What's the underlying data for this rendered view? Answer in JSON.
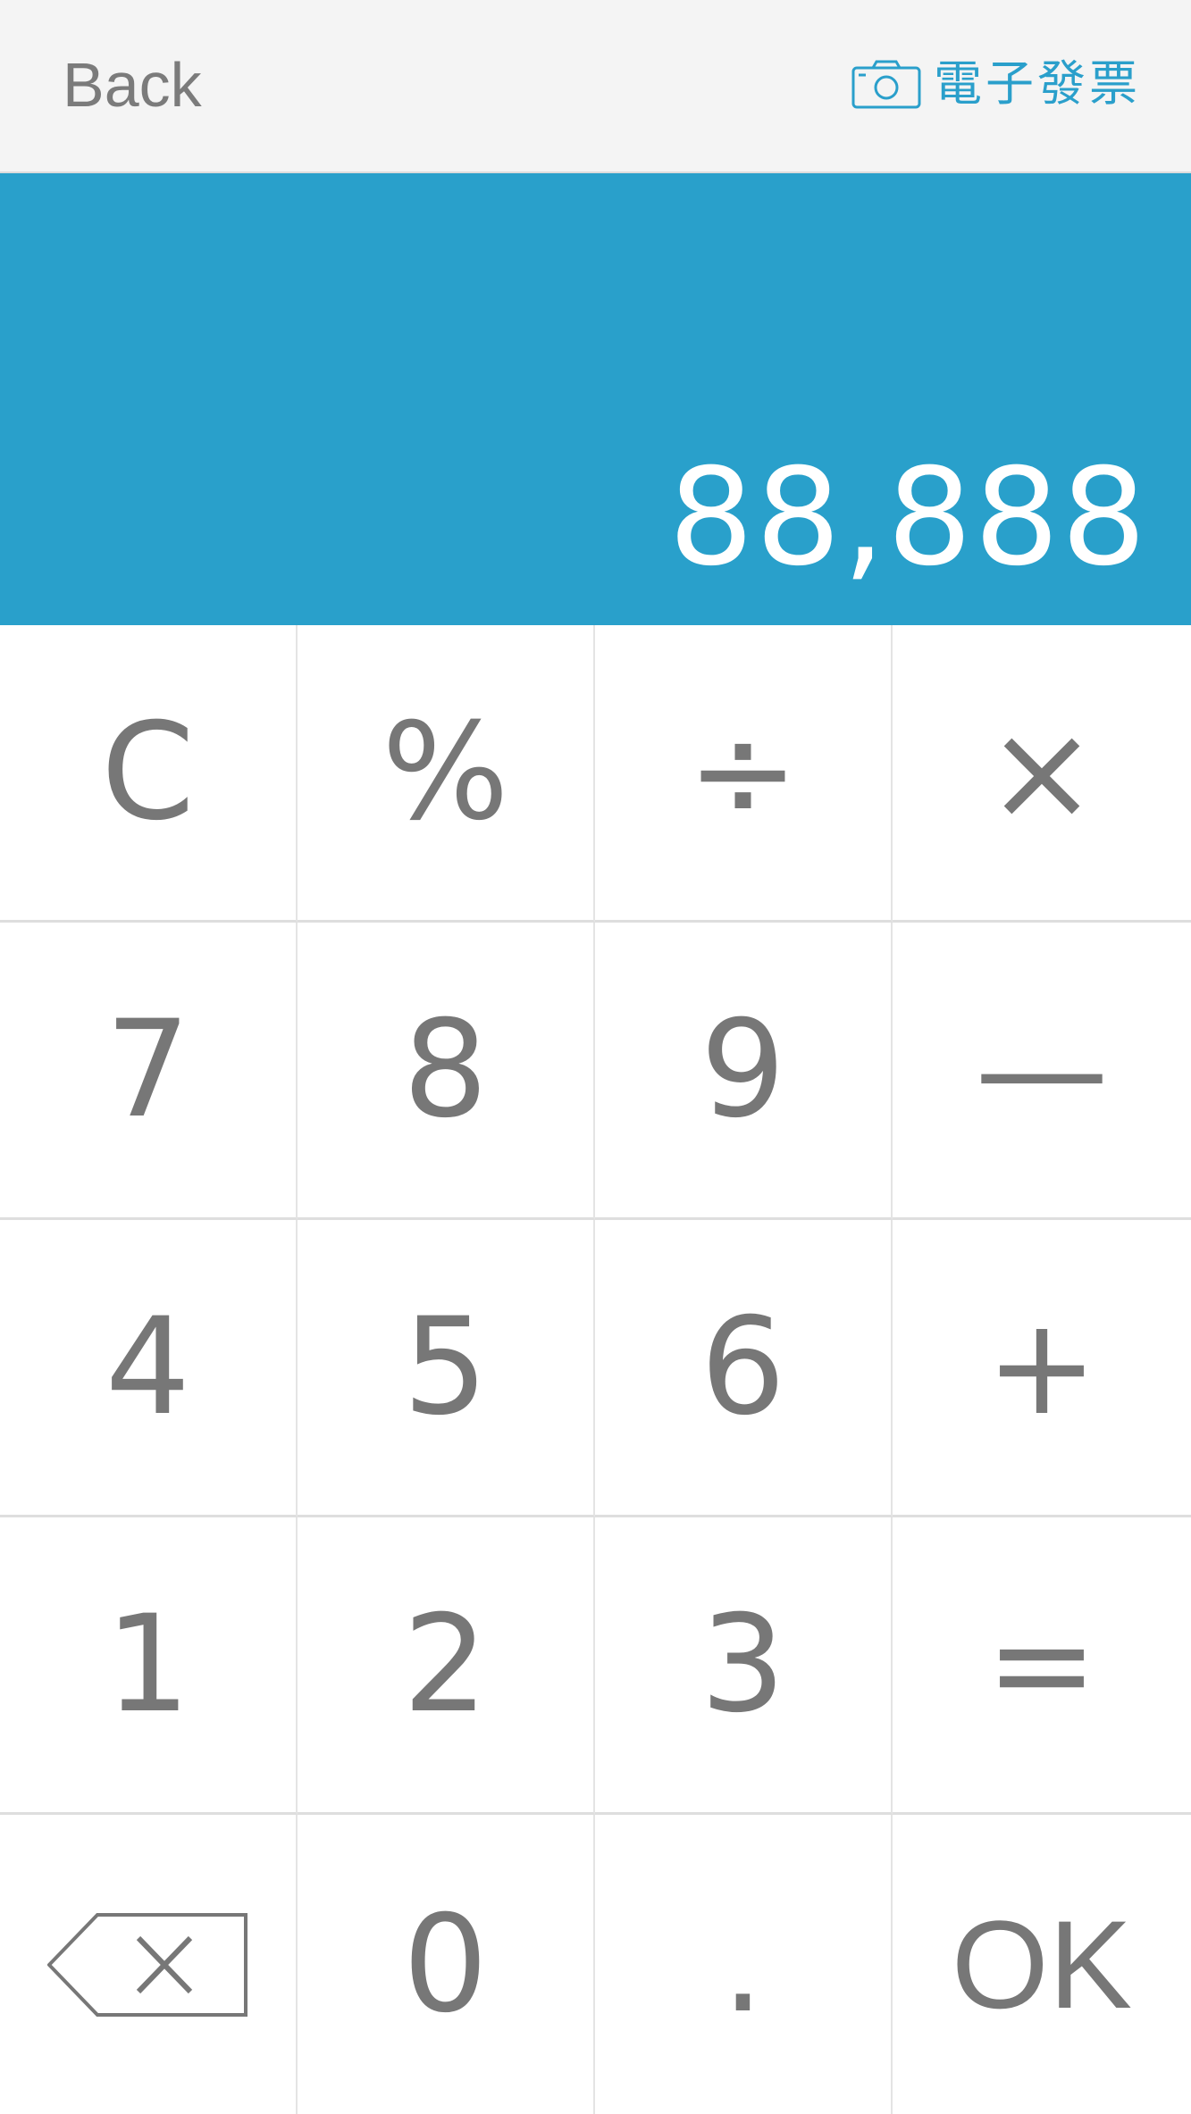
{
  "header": {
    "back_label": "Back",
    "invoice_label": "電子發票",
    "invoice_icon": "camera-icon",
    "accent_color": "#2a9fcb"
  },
  "display": {
    "value": "88,888",
    "background_color": "#29a0cb"
  },
  "keypad": {
    "clear": "C",
    "percent": "%",
    "divide": "÷",
    "multiply": "×",
    "seven": "7",
    "eight": "8",
    "nine": "9",
    "minus": "—",
    "four": "4",
    "five": "5",
    "six": "6",
    "plus": "+",
    "one": "1",
    "two": "2",
    "three": "3",
    "equals": "=",
    "backspace_icon": "backspace-icon",
    "zero": "0",
    "decimal": ".",
    "ok": "OK"
  }
}
